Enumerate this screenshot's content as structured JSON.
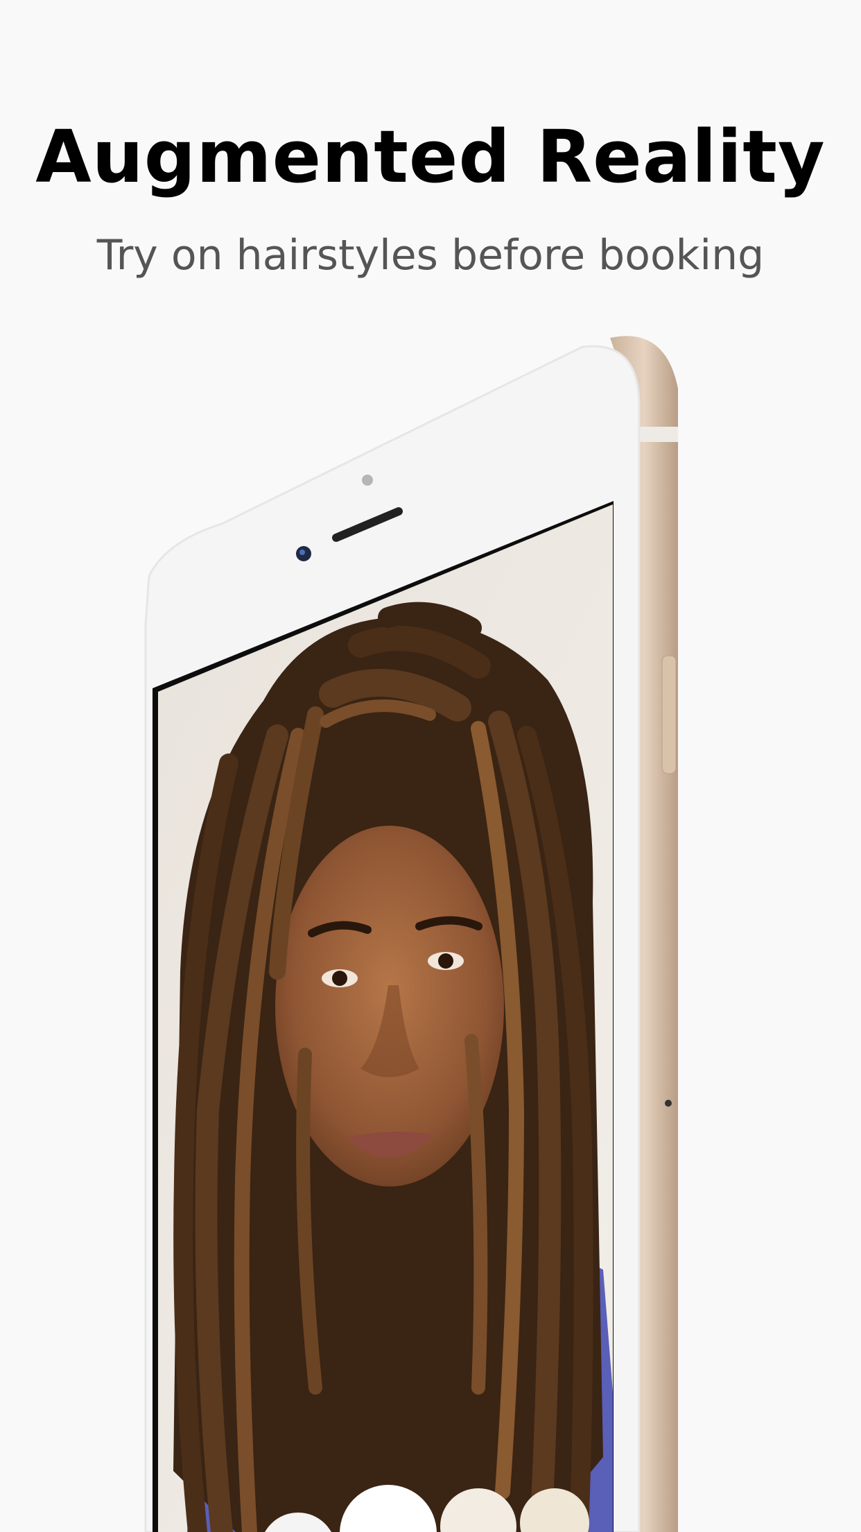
{
  "marketing": {
    "headline": "Augmented Reality",
    "subheadline": "Try on hairstyles before booking"
  },
  "device": {
    "frame_color": "#d9c3ad",
    "bezel_color": "#f4f4f4",
    "screen_content": "camera-preview-icon"
  },
  "colors": {
    "background": "#f9f9f9",
    "headline": "#000000",
    "subheadline": "#555555",
    "shirt": "#5a5fb8"
  }
}
